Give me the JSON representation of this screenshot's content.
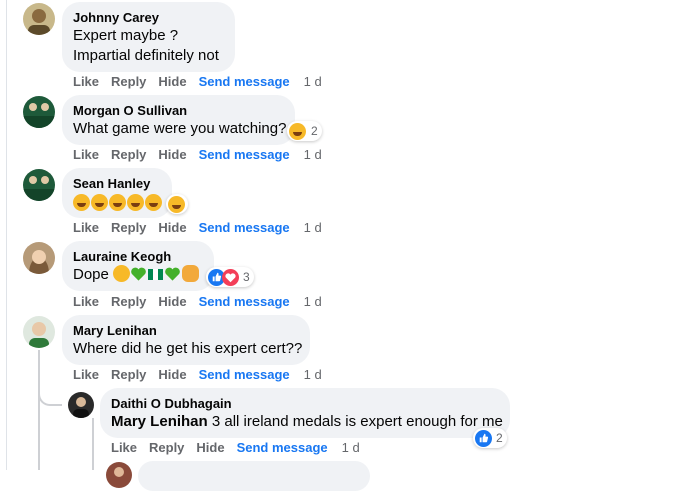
{
  "actions": {
    "like": "Like",
    "reply": "Reply",
    "hide": "Hide",
    "send_message": "Send message"
  },
  "colors": {
    "link": "#1877f2",
    "meta": "#65676b",
    "bubble": "#f0f2f5"
  },
  "comments": [
    {
      "author": "Johnny Carey",
      "lines": [
        "Expert maybe ?",
        "Impartial definitely not"
      ],
      "time": "1 d"
    },
    {
      "author": "Morgan O Sullivan",
      "text": "What game were you watching?",
      "reaction_icon": "laughing-reaction",
      "reaction_count": "2",
      "time": "1 d"
    },
    {
      "author": "Sean Hanley",
      "emoji": [
        "rolling-on-floor-laughing",
        "rolling-on-floor-laughing",
        "rolling-on-floor-laughing",
        "rolling-on-floor-laughing",
        "rolling-on-floor-laughing"
      ],
      "reaction_icon": "laughing-reaction",
      "time": "1 d"
    },
    {
      "author": "Lauraine Keogh",
      "text": "Dope",
      "emoji": [
        "pleading-face",
        "green-heart",
        "nigeria-flag",
        "green-heart",
        "flexed-biceps"
      ],
      "reaction_icons": [
        "like-reaction",
        "love-reaction"
      ],
      "reaction_count": "3",
      "time": "1 d"
    },
    {
      "author": "Mary Lenihan",
      "text": "Where did he get his expert cert??",
      "time": "1 d"
    }
  ],
  "reply": {
    "author": "Daithi O Dubhagain",
    "mention": "Mary Lenihan",
    "text": "3 all ireland medals is expert enough for me",
    "reaction_icon": "like-reaction",
    "reaction_count": "2",
    "time": "1 d"
  }
}
